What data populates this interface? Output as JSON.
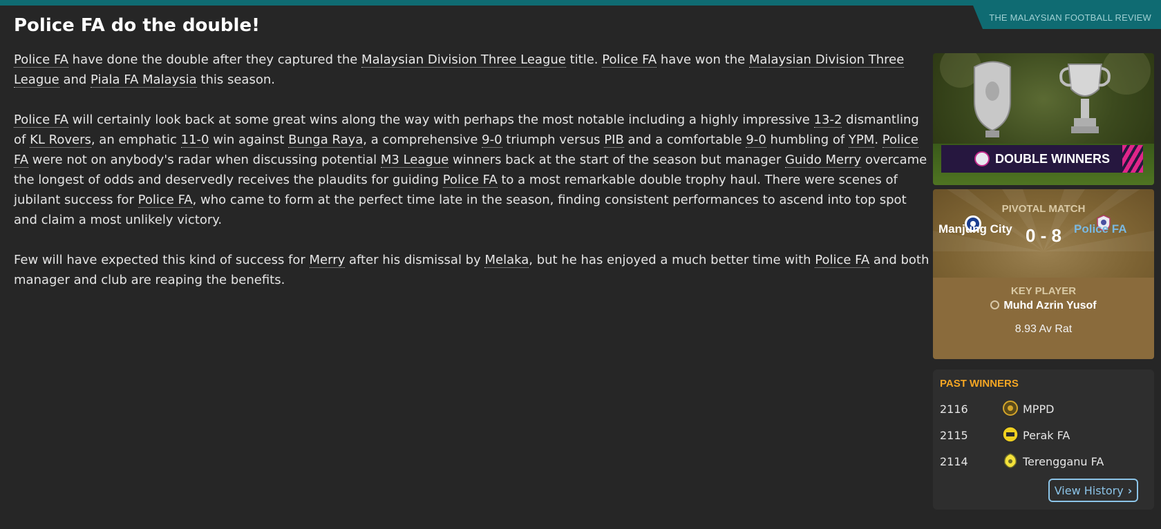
{
  "publication": "THE MALAYSIAN FOOTBALL REVIEW",
  "headline": "Police FA do the double!",
  "article": {
    "p1": [
      {
        "t": "Police FA",
        "link": true
      },
      {
        "t": " have done the double after they captured the "
      },
      {
        "t": "Malaysian Division Three League",
        "link": true
      },
      {
        "t": " title. "
      },
      {
        "t": "Police FA",
        "link": true
      },
      {
        "t": " have won the "
      },
      {
        "t": "Malaysian Division Three League",
        "link": true
      },
      {
        "t": " and "
      },
      {
        "t": "Piala FA Malaysia",
        "link": true
      },
      {
        "t": " this season."
      }
    ],
    "p2": [
      {
        "t": "Police FA",
        "link": true
      },
      {
        "t": " will certainly look back at some great wins along the way with perhaps the most notable including a highly impressive "
      },
      {
        "t": "13-2",
        "link": true
      },
      {
        "t": " dismantling of "
      },
      {
        "t": "KL Rovers",
        "link": true
      },
      {
        "t": ", an emphatic "
      },
      {
        "t": "11-0",
        "link": true
      },
      {
        "t": " win against "
      },
      {
        "t": "Bunga Raya",
        "link": true
      },
      {
        "t": ", a comprehensive "
      },
      {
        "t": "9-0",
        "link": true
      },
      {
        "t": " triumph versus "
      },
      {
        "t": "PIB",
        "link": true
      },
      {
        "t": " and a comfortable "
      },
      {
        "t": "9-0",
        "link": true
      },
      {
        "t": " humbling of "
      },
      {
        "t": "YPM",
        "link": true
      },
      {
        "t": ". "
      },
      {
        "t": "Police FA",
        "link": true
      },
      {
        "t": " were not on anybody's radar when discussing potential "
      },
      {
        "t": "M3 League",
        "link": true
      },
      {
        "t": " winners back at the start of the season but manager "
      },
      {
        "t": "Guido Merry",
        "link": true
      },
      {
        "t": " overcame the longest of odds and deservedly receives the plaudits for guiding "
      },
      {
        "t": "Police FA",
        "link": true
      },
      {
        "t": " to a most remarkable double trophy haul. There were scenes of jubilant success for "
      },
      {
        "t": "Police FA",
        "link": true
      },
      {
        "t": ", who came to form at the perfect time late in the season, finding consistent performances to ascend into top spot and claim a most unlikely victory."
      }
    ],
    "p3": [
      {
        "t": "Few will have expected this kind of success for "
      },
      {
        "t": "Merry",
        "link": true
      },
      {
        "t": " after his dismissal by "
      },
      {
        "t": "Melaka",
        "link": true
      },
      {
        "t": ", but he has enjoyed a much better time with "
      },
      {
        "t": "Police FA",
        "link": true
      },
      {
        "t": " and both manager and club are reaping the benefits."
      }
    ]
  },
  "hero": {
    "banner": "DOUBLE WINNERS"
  },
  "pivotal": {
    "label": "PIVOTAL MATCH",
    "home": "Manjung City",
    "away": "Police FA",
    "score": "0 - 8",
    "home_color": "#ffffff",
    "away_color": "#7ab8e0"
  },
  "key_player": {
    "label": "KEY PLAYER",
    "name": "Muhd Azrin Yusof",
    "rating": "8.93 Av Rat"
  },
  "past_winners": {
    "title": "PAST WINNERS",
    "rows": [
      {
        "year": "2116",
        "club": "MPPD",
        "icon": "mppd-crest-icon"
      },
      {
        "year": "2115",
        "club": "Perak FA",
        "icon": "perak-crest-icon"
      },
      {
        "year": "2114",
        "club": "Terengganu FA",
        "icon": "terengganu-crest-icon"
      }
    ],
    "button": "View History"
  }
}
